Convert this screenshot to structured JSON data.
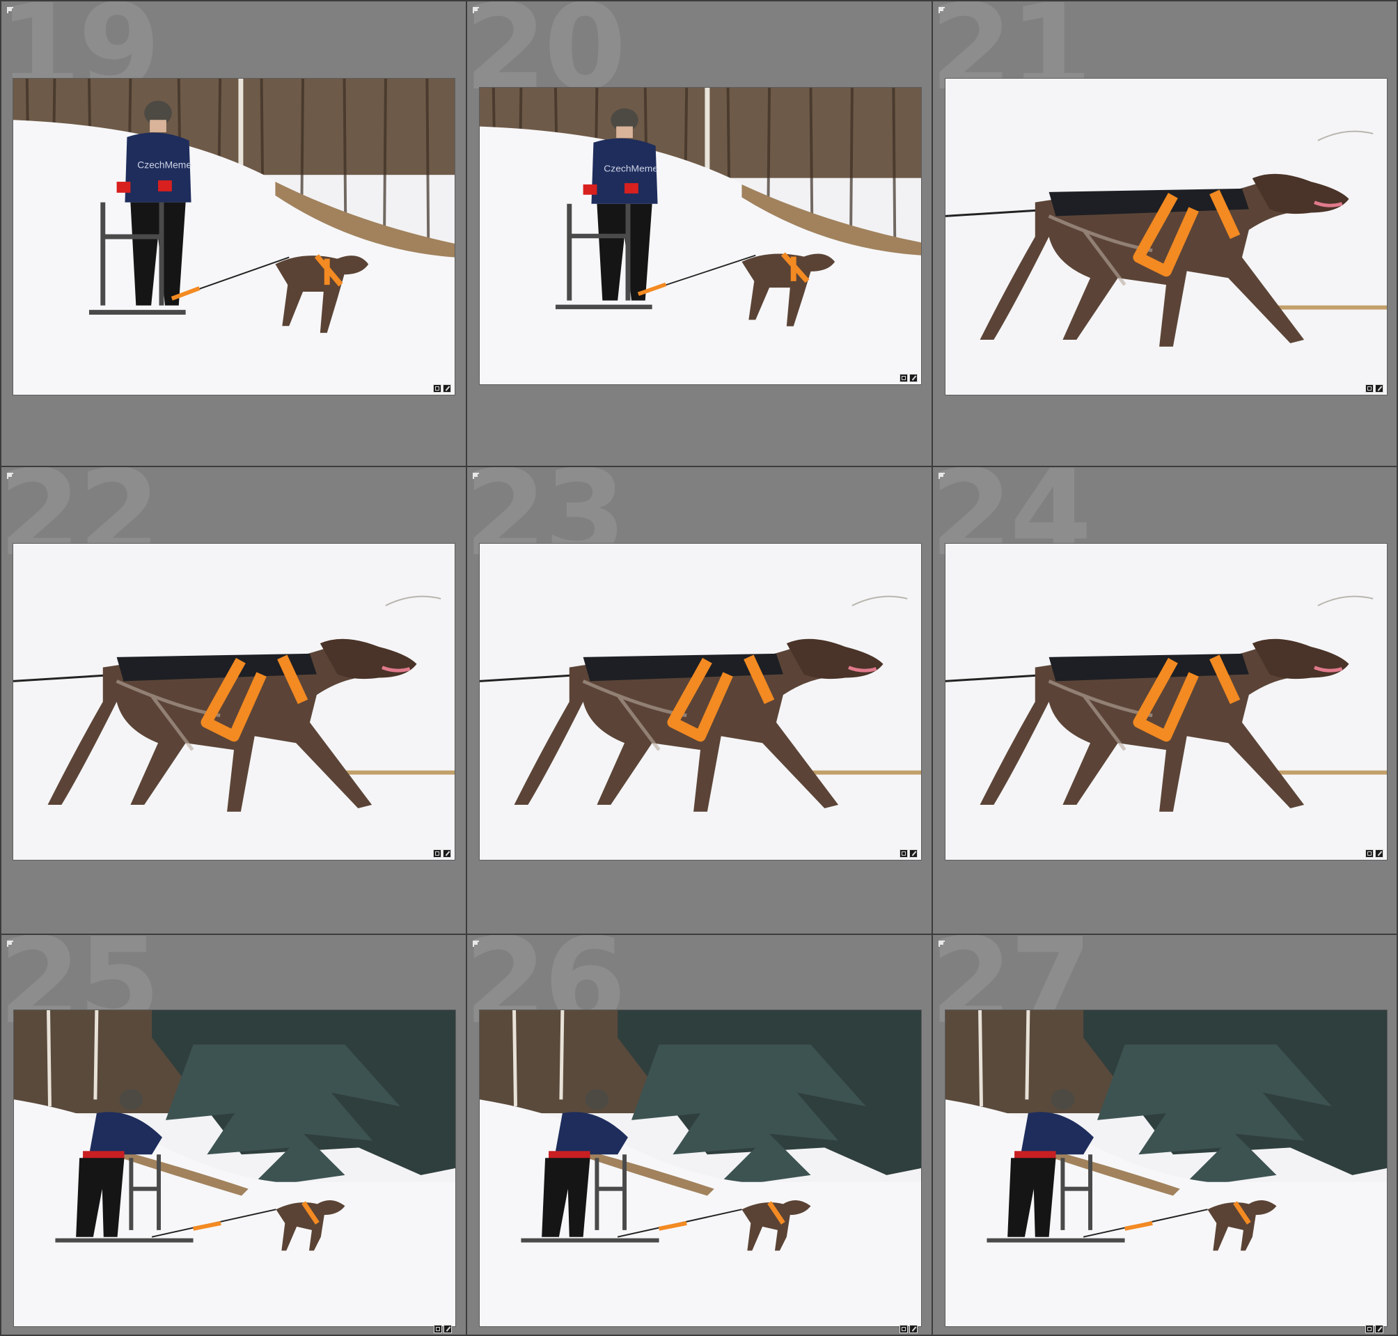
{
  "grid": {
    "cells": [
      {
        "index": "19",
        "scene": "musher"
      },
      {
        "index": "20",
        "scene": "musher"
      },
      {
        "index": "21",
        "scene": "dog"
      },
      {
        "index": "22",
        "scene": "dog"
      },
      {
        "index": "23",
        "scene": "dog"
      },
      {
        "index": "24",
        "scene": "dog"
      },
      {
        "index": "25",
        "scene": "trees"
      },
      {
        "index": "26",
        "scene": "trees"
      },
      {
        "index": "27",
        "scene": "trees"
      }
    ],
    "hoodie_text": "CzechMeme"
  },
  "colors": {
    "cell_bg": "#808080",
    "harness": "#f38a22",
    "hoodie": "#1e2d5c",
    "dog": "#4a3328",
    "snow": "#f4f4f6"
  },
  "icons": {
    "flag": "flag-icon",
    "crop": "crop-badge-icon",
    "edit": "develop-adjusted-icon"
  }
}
